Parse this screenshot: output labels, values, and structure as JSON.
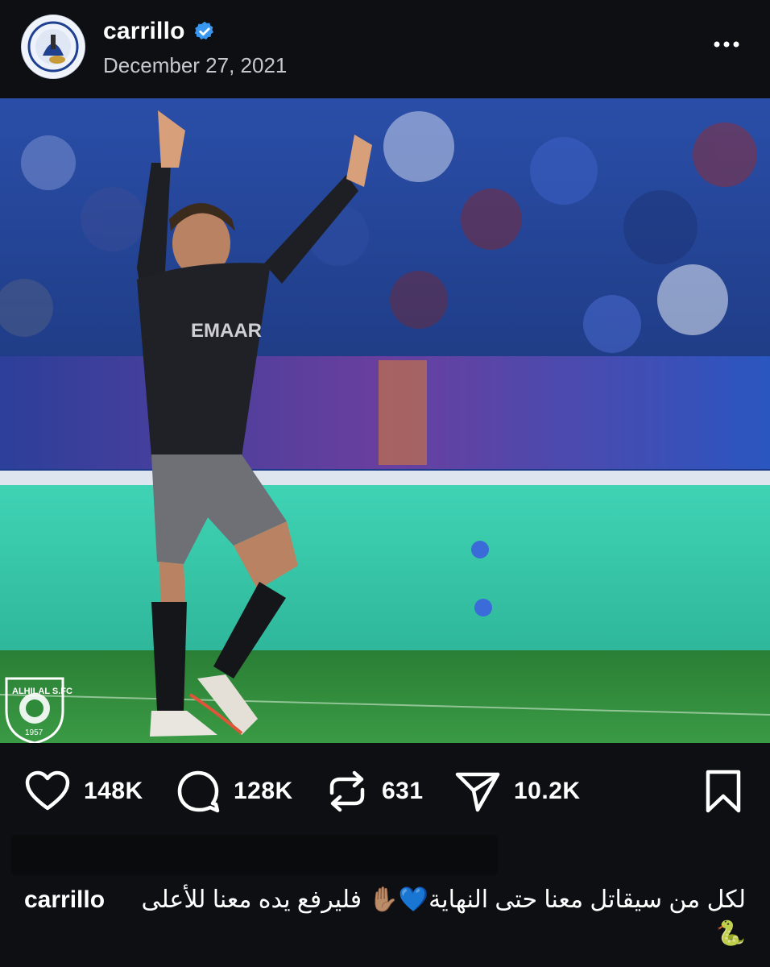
{
  "post": {
    "username": "carrillo",
    "date": "December 27, 2021"
  },
  "icons": {
    "avatar": "al-hilal-crest-avatar",
    "verified": "verified-badge-icon",
    "more": "more-horizontal-icon",
    "like": "heart-icon",
    "comment": "comment-icon",
    "repost": "repost-icon",
    "share": "send-icon",
    "save": "bookmark-icon"
  },
  "photo": {
    "shirt_text": "EMAAR",
    "badge_text": "ALHILAL S.FC",
    "badge_year": "1957"
  },
  "actions": {
    "likes": "148K",
    "comments": "128K",
    "reposts": "631",
    "shares": "10.2K"
  },
  "caption": {
    "username": "carrillo",
    "text": "لكل من سيقاتل معنا حتى النهاية💙✋🏽 فليرفع يده معنا للأعلى🐍"
  },
  "colors": {
    "background": "#0d0f12",
    "verified_blue": "#3897f0",
    "club_blue": "#1f4fb4",
    "pitch_green": "#2f8a3a"
  }
}
